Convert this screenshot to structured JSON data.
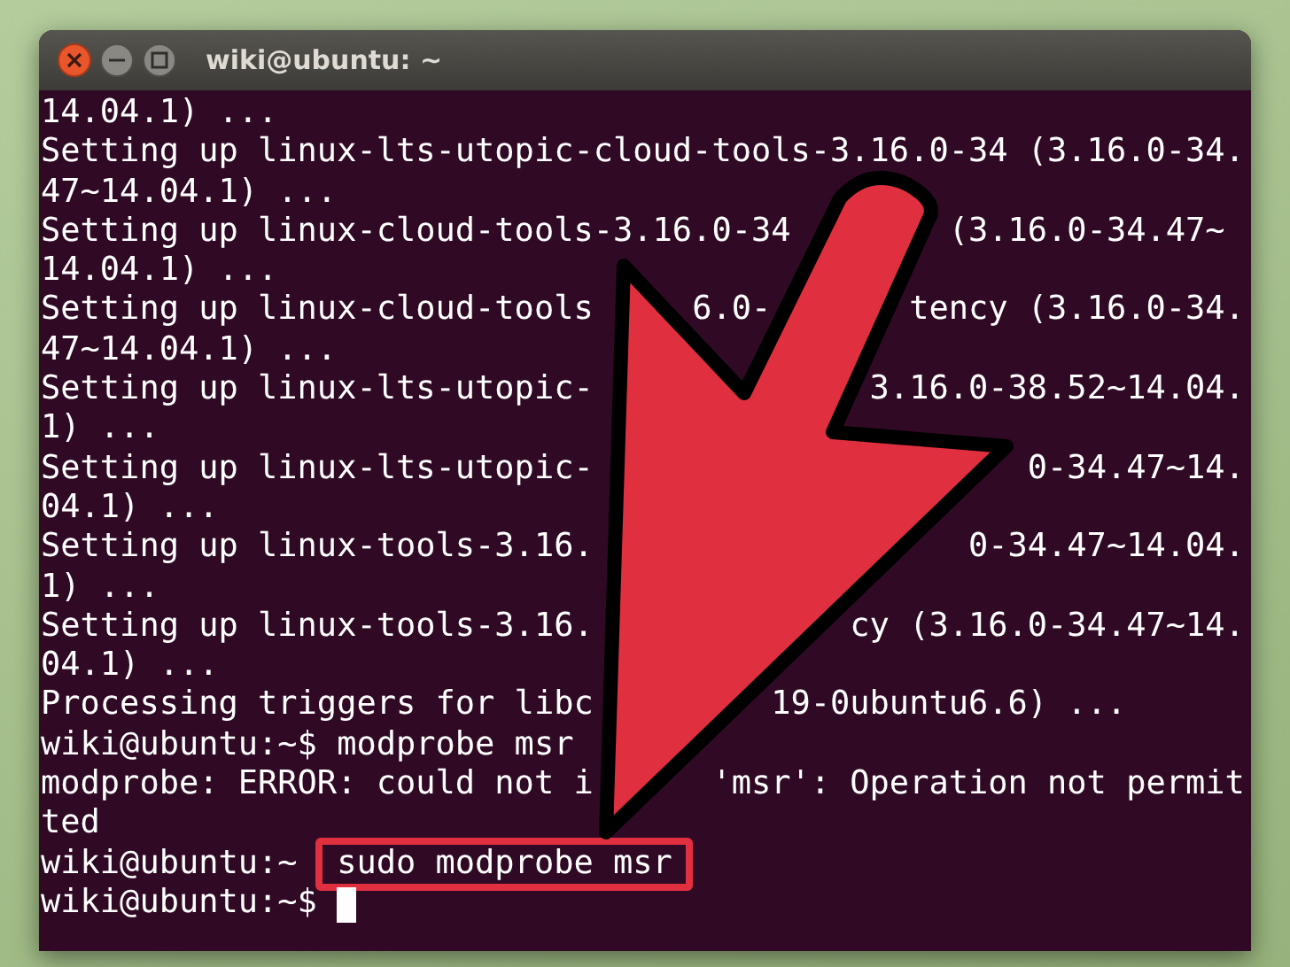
{
  "window": {
    "title": "wiki@ubuntu: ~"
  },
  "terminal": {
    "lines": [
      {
        "parts": [
          "14.04.1) ..."
        ],
        "highlighted": false,
        "cursor": false
      },
      {
        "parts": [
          "Setting up linux-lts-utopic-cloud-tools-3.16.0-34 (3.16.0-34."
        ],
        "highlighted": false,
        "cursor": false
      },
      {
        "parts": [
          "47~14.04.1) ..."
        ],
        "highlighted": false,
        "cursor": false
      },
      {
        "parts": [
          "Setting up linux-cloud-tools-3.16.0-34",
          "(3.16.0-34.47~"
        ],
        "highlighted": false,
        "cursor": false
      },
      {
        "parts": [
          "14.04.1) ..."
        ],
        "highlighted": false,
        "cursor": false
      },
      {
        "parts": [
          "Setting up linux-cloud-tools",
          "6.0-",
          "tency (3.16.0-34."
        ],
        "highlighted": false,
        "cursor": false
      },
      {
        "parts": [
          "47~14.04.1) ..."
        ],
        "highlighted": false,
        "cursor": false
      },
      {
        "parts": [
          "Setting up linux-lts-utopic-",
          "3.16.0-38.52~14.04."
        ],
        "highlighted": false,
        "cursor": false
      },
      {
        "parts": [
          "1) ..."
        ],
        "highlighted": false,
        "cursor": false
      },
      {
        "parts": [
          "Setting up linux-lts-utopic-",
          "0-34.47~14."
        ],
        "highlighted": false,
        "cursor": false
      },
      {
        "parts": [
          "04.1) ..."
        ],
        "highlighted": false,
        "cursor": false
      },
      {
        "parts": [
          "Setting up linux-tools-3.16.",
          "0-34.47~14.04."
        ],
        "highlighted": false,
        "cursor": false
      },
      {
        "parts": [
          "1) ..."
        ],
        "highlighted": false,
        "cursor": false
      },
      {
        "parts": [
          "Setting up linux-tools-3.16.",
          "cy (3.16.0-34.47~14."
        ],
        "highlighted": false,
        "cursor": false
      },
      {
        "parts": [
          "04.1) ..."
        ],
        "highlighted": false,
        "cursor": false
      },
      {
        "parts": [
          "Processing triggers for libc",
          "19-0ubuntu6.6) ..."
        ],
        "highlighted": false,
        "cursor": false
      },
      {
        "parts": [
          "wiki@ubuntu:~$ modprobe msr"
        ],
        "highlighted": false,
        "cursor": false
      },
      {
        "parts": [
          "modprobe: ERROR: could not i",
          "'msr': Operation not permit"
        ],
        "highlighted": false,
        "cursor": false
      },
      {
        "parts": [
          "ted"
        ],
        "highlighted": false,
        "cursor": false
      },
      {
        "parts": [
          "wiki@ubuntu:~",
          "sudo modprobe msr"
        ],
        "highlighted": true,
        "cursor": false
      },
      {
        "parts": [
          "wiki@ubuntu:~$"
        ],
        "highlighted": false,
        "cursor": true
      }
    ]
  }
}
